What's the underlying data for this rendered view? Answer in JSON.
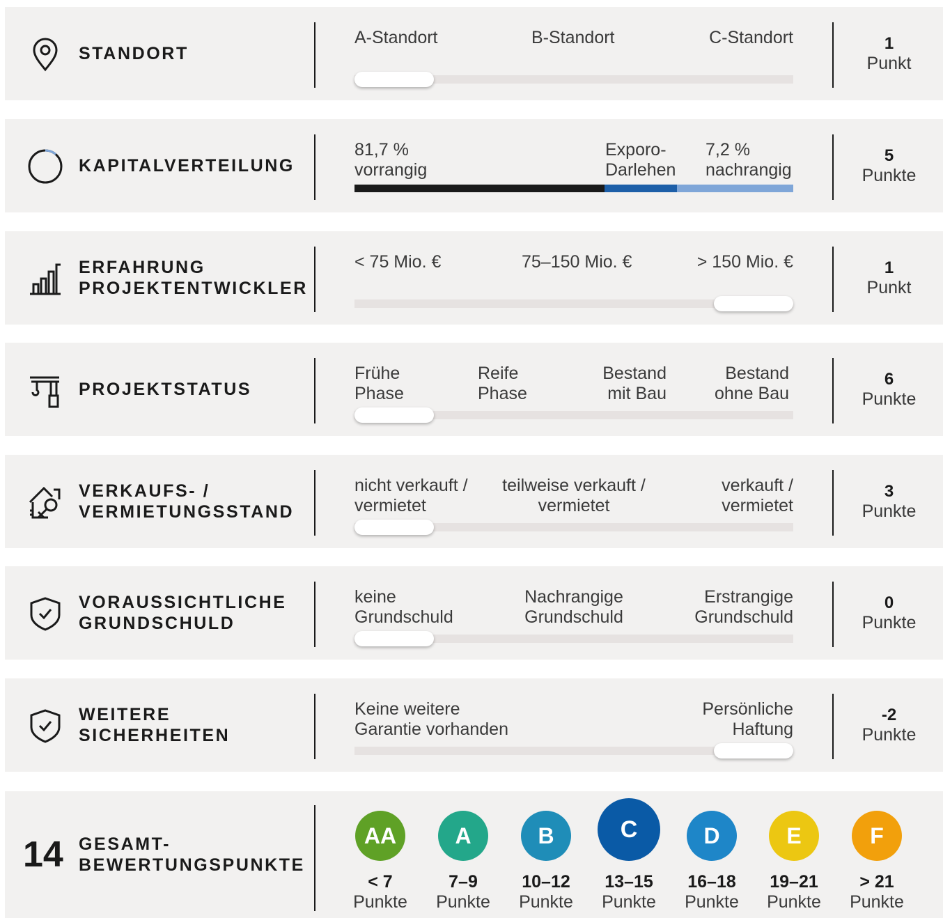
{
  "rows": [
    {
      "title": "STANDORT",
      "icon": "location-pin-icon",
      "labels": [
        "A-Standort",
        "B-Standort",
        "C-Standort"
      ],
      "selected": 0,
      "score": "1",
      "unit": "Punkt"
    },
    {
      "title": "KAPITALVERTEILUNG",
      "icon": "ring-icon",
      "labels": [
        "81,7 %\nvorrangig",
        "Exporo-\nDarlehen",
        "7,2 %\nnachrangig"
      ],
      "senior_share": 0.817,
      "exporo_share": 0.111,
      "junior_share": 0.072,
      "colors": {
        "senior": "#1a1a1a",
        "exporo": "#1d5fa8",
        "junior": "#7fa6d8"
      },
      "score": "5",
      "unit": "Punkte"
    },
    {
      "title": "ERFAHRUNG\nPROJEKTENTWICKLER",
      "icon": "bar-chart-icon",
      "labels": [
        "< 75 Mio. €",
        "75–150 Mio. €",
        "> 150 Mio. €"
      ],
      "selected": 2,
      "score": "1",
      "unit": "Punkt"
    },
    {
      "title": "PROJEKTSTATUS",
      "icon": "crane-icon",
      "labels": [
        "Frühe\nPhase",
        "Reife\nPhase",
        "Bestand\nmit Bau",
        "Bestand\nohne Bau"
      ],
      "selected": 0,
      "score": "6",
      "unit": "Punkte"
    },
    {
      "title": "VERKAUFS- /\nVERMIETUNGSSTAND",
      "icon": "house-key-icon",
      "labels": [
        "nicht verkauft /\nvermietet",
        "teilweise verkauft /\nvermietet",
        "verkauft /\nvermietet"
      ],
      "selected": 0,
      "score": "3",
      "unit": "Punkte"
    },
    {
      "title": "VORAUSSICHTLICHE\nGRUNDSCHULD",
      "icon": "shield-check-icon",
      "labels": [
        "keine\nGrundschuld",
        "Nachrangige\nGrundschuld",
        "Erstrangige\nGrundschuld"
      ],
      "selected": 0,
      "score": "0",
      "unit": "Punkte"
    },
    {
      "title": "WEITERE\nSICHERHEITEN",
      "icon": "shield-check-icon",
      "labels": [
        "Keine weitere\nGarantie vorhanden",
        "Persönliche\nHaftung"
      ],
      "selected": 1,
      "score": "-2",
      "unit": "Punkte"
    }
  ],
  "total": {
    "value": "14",
    "title": "GESAMT-\nBEWERTUNGSPUNKTE",
    "active_grade": "C"
  },
  "grades": [
    {
      "letter": "AA",
      "range": "< 7",
      "unit": "Punkte",
      "color": "#5fa126"
    },
    {
      "letter": "A",
      "range": "7–9",
      "unit": "Punkte",
      "color": "#23a78a"
    },
    {
      "letter": "B",
      "range": "10–12",
      "unit": "Punkte",
      "color": "#1f8db8"
    },
    {
      "letter": "C",
      "range": "13–15",
      "unit": "Punkte",
      "color": "#0a5aa6"
    },
    {
      "letter": "D",
      "range": "16–18",
      "unit": "Punkte",
      "color": "#1e86c8"
    },
    {
      "letter": "E",
      "range": "19–21",
      "unit": "Punkte",
      "color": "#ecc712"
    },
    {
      "letter": "F",
      "range": "> 21",
      "unit": "Punkte",
      "color": "#f2a00c"
    }
  ]
}
